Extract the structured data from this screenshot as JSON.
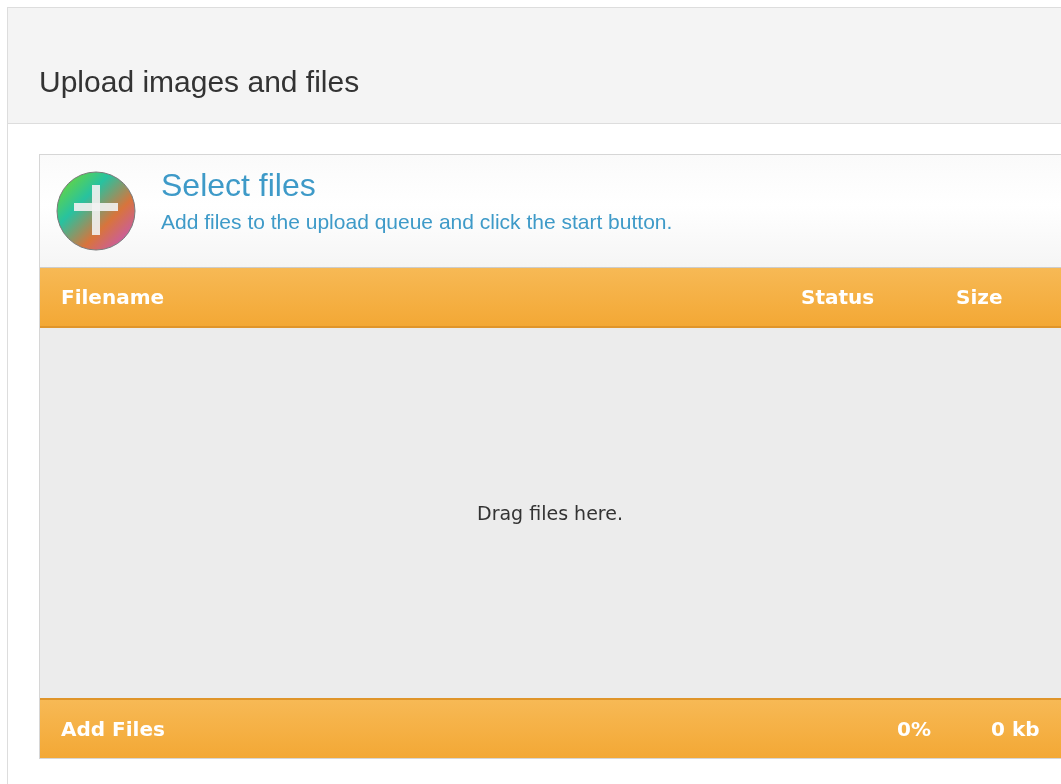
{
  "panel": {
    "title": "Upload images and files"
  },
  "uploader": {
    "heading": "Select files",
    "subtitle": "Add files to the upload queue and click the start button.",
    "columns": [
      "Filename",
      "Status",
      "Size"
    ],
    "drop_hint": "Drag files here.",
    "footer": {
      "add_button": "Add Files",
      "percent": "0%",
      "total_size": "0 kb"
    }
  }
}
